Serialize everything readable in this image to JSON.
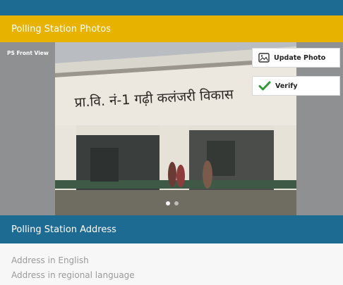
{
  "photos_section": {
    "title": "Polling Station Photos",
    "photo_caption": "PS Front View",
    "building_sign_text": "प्रा.वि. नं-1 गढ़ी कलंजरी विकास",
    "update_photo_label": "Update Photo",
    "verify_label": "Verify",
    "carousel": {
      "total": 2,
      "active_index": 0
    }
  },
  "address_section": {
    "title": "Polling Station Address",
    "address_english": "Address in English",
    "address_regional": "Address in regional language"
  },
  "colors": {
    "top_bar": "#1d6a93",
    "photos_header": "#e8b300",
    "address_header": "#1d6a93",
    "verify_check": "#2e9c3a"
  },
  "icons": {
    "update_photo": "image-icon",
    "verify": "checkmark-icon"
  }
}
